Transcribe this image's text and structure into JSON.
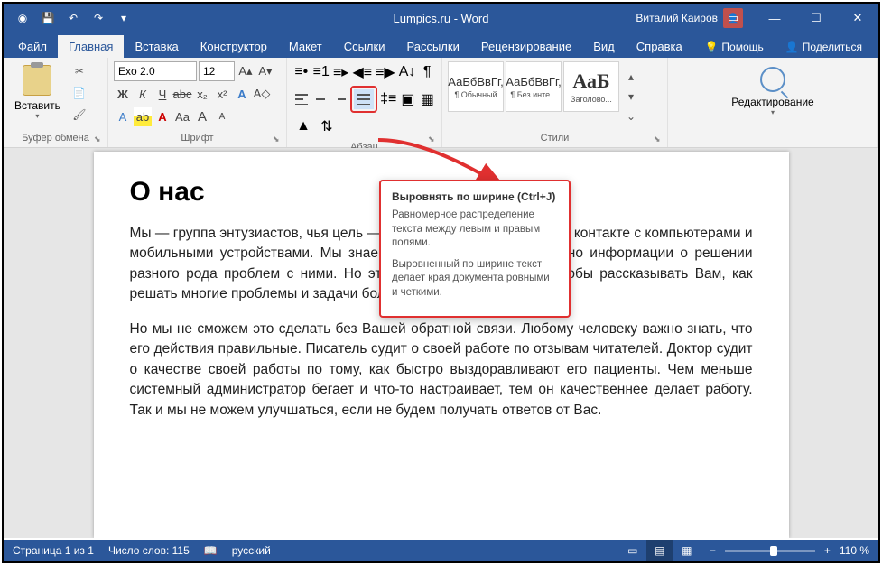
{
  "title": "Lumpics.ru - Word",
  "user": "Виталий Каиров",
  "tabs": {
    "file": "Файл",
    "home": "Главная",
    "insert": "Вставка",
    "design": "Конструктор",
    "layout": "Макет",
    "references": "Ссылки",
    "mailings": "Рассылки",
    "review": "Рецензирование",
    "view": "Вид",
    "help": "Справка",
    "tell_me": "Помощь",
    "share": "Поделиться"
  },
  "ribbon": {
    "clipboard": {
      "label": "Буфер обмена",
      "paste": "Вставить"
    },
    "font": {
      "label": "Шрифт",
      "name": "Exo 2.0",
      "size": "12"
    },
    "paragraph": {
      "label": "Абзац"
    },
    "styles": {
      "label": "Стили",
      "s1_prev": "АаБбВвГг,",
      "s1_name": "¶ Обычный",
      "s2_prev": "АаБбВвГг,",
      "s2_name": "¶ Без инте...",
      "s3_prev": "АаБ",
      "s3_name": "Заголово..."
    },
    "editing": {
      "label": "Редактирование"
    }
  },
  "tooltip": {
    "title": "Выровнять по ширине (Ctrl+J)",
    "p1": "Равномерное распределение текста между левым и правым полями.",
    "p2": "Выровненный по ширине текст делает края документа ровными и четкими."
  },
  "document": {
    "heading": "О нас",
    "p1": "Мы — группа энтузиастов, чья цель — помогать Вам в ежедневном контакте с компьютерами и мобильными устройствами. Мы знаем, что в интернете уже полно информации о решении разного рода проблем с ними. Но это не останавливает нас, чтобы рассказывать Вам, как решать многие проблемы и задачи более качественно и быстрее.",
    "p2": "Но мы не сможем это сделать без Вашей обратной связи. Любому человеку важно знать, что его действия правильные. Писатель судит о своей работе по отзывам читателей. Доктор судит о качестве своей работы по тому, как быстро выздоравливают его пациенты. Чем меньше системный администратор бегает и что-то настраивает, тем он качественнее делает работу. Так и мы не можем улучшаться, если не будем получать ответов от Вас."
  },
  "statusbar": {
    "page": "Страница 1 из 1",
    "words": "Число слов: 115",
    "lang": "русский",
    "zoom": "110 %"
  }
}
